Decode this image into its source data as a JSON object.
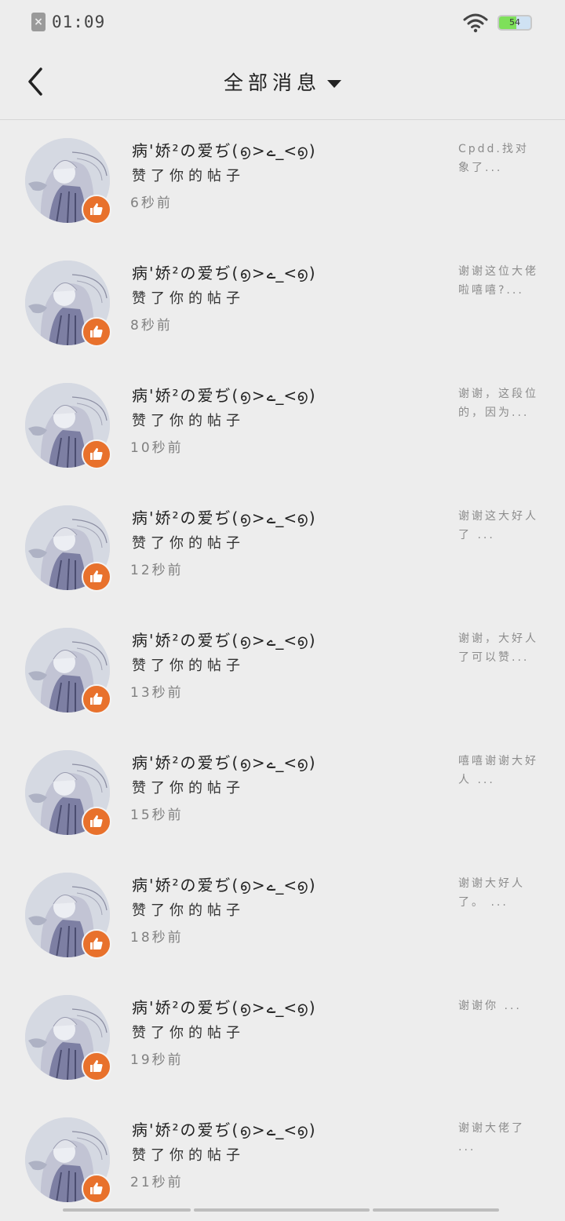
{
  "status_bar": {
    "sim_icon": "sim-x-icon",
    "sim_glyph": "×",
    "time": "01:09",
    "wifi_icon": "wifi-icon",
    "battery_level": "54",
    "battery_fill_color": "#7ee05a"
  },
  "header": {
    "back_icon": "back-arrow-icon",
    "title": "全部消息",
    "dropdown_icon": "caret-down-icon"
  },
  "accent_color": "#e8712c",
  "messages": [
    {
      "sender": "病'娇²の爱ぢ(൭>ے_<൭)",
      "action": "赞了你的帖子",
      "time": "6秒前",
      "preview": "Cpdd.找对象了..."
    },
    {
      "sender": "病'娇²の爱ぢ(൭>ے_<൭)",
      "action": "赞了你的帖子",
      "time": "8秒前",
      "preview": "谢谢这位大佬啦嘻嘻?..."
    },
    {
      "sender": "病'娇²の爱ぢ(൭>ے_<൭)",
      "action": "赞了你的帖子",
      "time": "10秒前",
      "preview": "谢谢，这段位的，因为..."
    },
    {
      "sender": "病'娇²の爱ぢ(൭>ے_<൭)",
      "action": "赞了你的帖子",
      "time": "12秒前",
      "preview": "谢谢这大好人了 ..."
    },
    {
      "sender": "病'娇²の爱ぢ(൭>ے_<൭)",
      "action": "赞了你的帖子",
      "time": "13秒前",
      "preview": "谢谢，大好人了可以赞..."
    },
    {
      "sender": "病'娇²の爱ぢ(൭>ے_<൭)",
      "action": "赞了你的帖子",
      "time": "15秒前",
      "preview": "嘻嘻谢谢大好人 ..."
    },
    {
      "sender": "病'娇²の爱ぢ(൭>ے_<൭)",
      "action": "赞了你的帖子",
      "time": "18秒前",
      "preview": "谢谢大好人了。 ..."
    },
    {
      "sender": "病'娇²の爱ぢ(൭>ے_<൭)",
      "action": "赞了你的帖子",
      "time": "19秒前",
      "preview": "谢谢你 ..."
    },
    {
      "sender": "病'娇²の爱ぢ(൭>ے_<൭)",
      "action": "赞了你的帖子",
      "time": "21秒前",
      "preview": "谢谢大佬了 ..."
    }
  ]
}
